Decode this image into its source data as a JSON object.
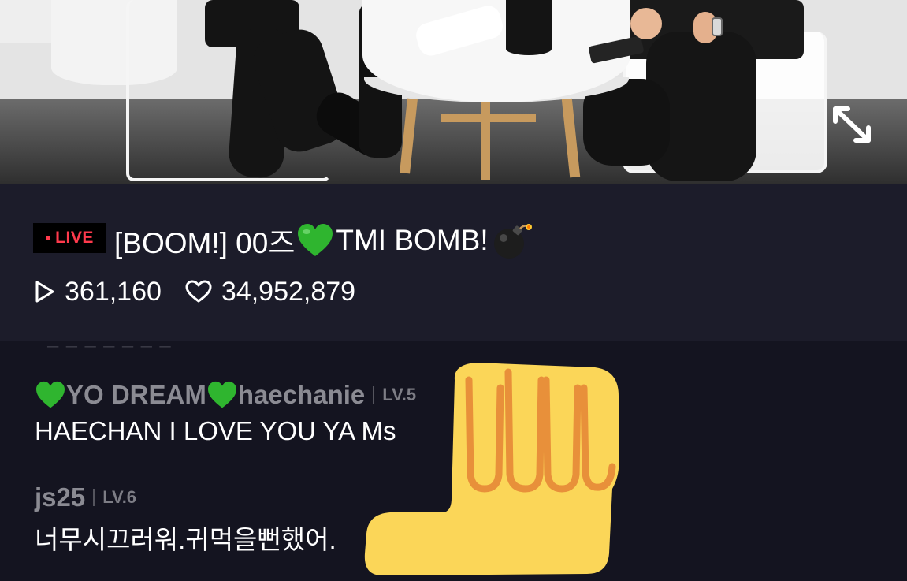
{
  "video": {
    "expand_icon": "expand-arrows-icon"
  },
  "stream": {
    "live_label": "LIVE",
    "title_prefix": "[BOOM!] 00즈",
    "title_suffix": "TMI BOMB!",
    "title_emojis": [
      "green-heart",
      "bomb"
    ],
    "views": "361,160",
    "likes": "34,952,879"
  },
  "chat": {
    "messages": [
      {
        "name_part1": "YO DREAM",
        "name_part2": "haechanie",
        "name_emojis": [
          "green-heart",
          "green-heart"
        ],
        "level": "LV.5",
        "text": "HAECHAN I LOVE YOU YA Ms"
      },
      {
        "name": "js25",
        "level": "LV.6",
        "text": "너무시끄러워.귀먹을뻔했어."
      }
    ]
  },
  "colors": {
    "live_red": "#ff3a4c",
    "panel_bg": "#1c1c2a",
    "chat_bg": "#141420",
    "username_gray": "#8b8b93",
    "heart_green": "#2fb52f",
    "sticker_yellow": "#fbd658",
    "sticker_orange": "#e8903a"
  }
}
